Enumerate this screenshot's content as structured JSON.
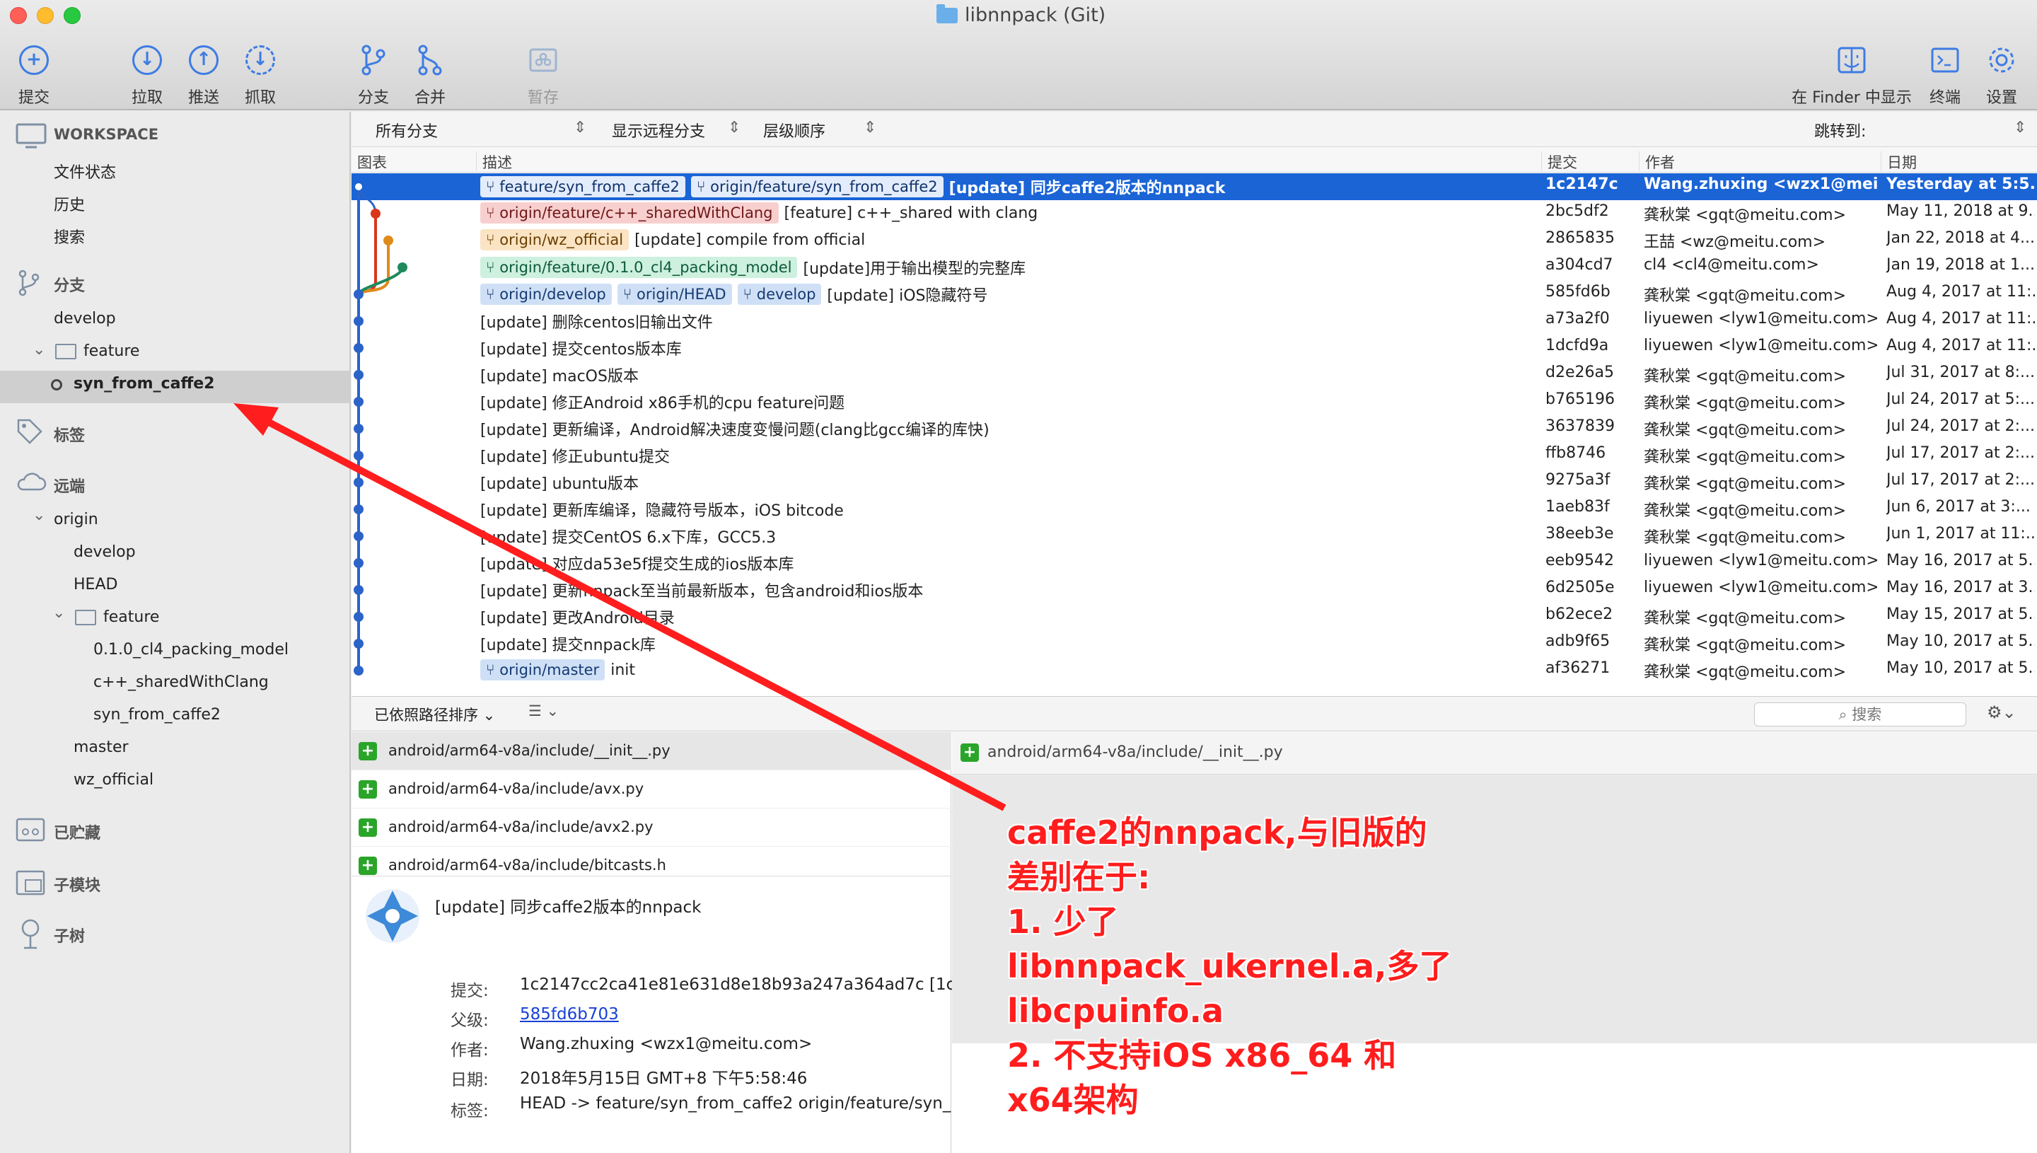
{
  "window": {
    "title": "libnnpack (Git)"
  },
  "toolbar": {
    "commit": "提交",
    "pull": "拉取",
    "push": "推送",
    "fetch": "抓取",
    "branch": "分支",
    "merge": "合并",
    "stash": "暂存",
    "finder": "在 Finder 中显示",
    "terminal": "终端",
    "settings": "设置"
  },
  "sidebar": {
    "workspace": "WORKSPACE",
    "file_status": "文件状态",
    "history": "历史",
    "search": "搜索",
    "branches": "分支",
    "develop": "develop",
    "feature": "feature",
    "syn_from_caffe2": "syn_from_caffe2",
    "tags": "标签",
    "remotes": "远端",
    "origin": "origin",
    "r_develop": "develop",
    "r_head": "HEAD",
    "r_feature": "feature",
    "r_packing": "0.1.0_cl4_packing_model",
    "r_clang": "c++_sharedWithClang",
    "r_syn": "syn_from_caffe2",
    "r_master": "master",
    "r_wz": "wz_official",
    "stashes": "已贮藏",
    "submodules": "子模块",
    "subtrees": "子树"
  },
  "filter": {
    "branches": "所有分支",
    "remote": "显示远程分支",
    "order": "层级顺序",
    "jump": "跳转到:"
  },
  "columns": {
    "graph": "图表",
    "desc": "描述",
    "commit": "提交",
    "author": "作者",
    "date": "日期"
  },
  "commits": [
    {
      "tags": [
        {
          "t": "feature/syn_from_caffe2",
          "c": "blue"
        },
        {
          "t": "origin/feature/syn_from_caffe2",
          "c": "blue"
        }
      ],
      "msg": "[update] 同步caffe2版本的nnpack",
      "hash": "1c2147c",
      "author": "Wang.zhuxing <wzx1@meit...",
      "date": "Yesterday at 5:5..."
    },
    {
      "tags": [
        {
          "t": "origin/feature/c++_sharedWithClang",
          "c": "red"
        }
      ],
      "msg": "[feature] c++_shared with clang",
      "hash": "2bc5df2",
      "author": "龚秋棠 <gqt@meitu.com>",
      "date": "May 11, 2018 at 9..."
    },
    {
      "tags": [
        {
          "t": "origin/wz_official",
          "c": "orange"
        }
      ],
      "msg": "[update] compile from official",
      "hash": "2865835",
      "author": "王喆 <wz@meitu.com>",
      "date": "Jan 22, 2018 at 4..."
    },
    {
      "tags": [
        {
          "t": "origin/feature/0.1.0_cl4_packing_model",
          "c": "green"
        }
      ],
      "msg": "[update]用于输出模型的完整库",
      "hash": "a304cd7",
      "author": "cl4 <cl4@meitu.com>",
      "date": "Jan 19, 2018 at 1..."
    },
    {
      "tags": [
        {
          "t": "origin/develop",
          "c": "blue"
        },
        {
          "t": "origin/HEAD",
          "c": "blue"
        },
        {
          "t": "develop",
          "c": "blue"
        }
      ],
      "msg": "[update] iOS隐藏符号",
      "hash": "585fd6b",
      "author": "龚秋棠 <gqt@meitu.com>",
      "date": "Aug 4, 2017 at 11:..."
    },
    {
      "tags": [],
      "msg": "[update] 删除centos旧输出文件",
      "hash": "a73a2f0",
      "author": "liyuewen <lyw1@meitu.com>",
      "date": "Aug 4, 2017 at 11:..."
    },
    {
      "tags": [],
      "msg": "[update] 提交centos版本库",
      "hash": "1dcfd9a",
      "author": "liyuewen <lyw1@meitu.com>",
      "date": "Aug 4, 2017 at 11:..."
    },
    {
      "tags": [],
      "msg": "[update] macOS版本",
      "hash": "d2e26a5",
      "author": "龚秋棠 <gqt@meitu.com>",
      "date": "Jul 31, 2017 at 8:..."
    },
    {
      "tags": [],
      "msg": "[update] 修正Android x86手机的cpu feature问题",
      "hash": "b765196",
      "author": "龚秋棠 <gqt@meitu.com>",
      "date": "Jul 24, 2017 at 5:..."
    },
    {
      "tags": [],
      "msg": "[update] 更新编译，Android解决速度变慢问题(clang比gcc编译的库快)",
      "hash": "3637839",
      "author": "龚秋棠 <gqt@meitu.com>",
      "date": "Jul 24, 2017 at 2:..."
    },
    {
      "tags": [],
      "msg": "[update] 修正ubuntu提交",
      "hash": "ffb8746",
      "author": "龚秋棠 <gqt@meitu.com>",
      "date": "Jul 17, 2017 at 2:..."
    },
    {
      "tags": [],
      "msg": "[update] ubuntu版本",
      "hash": "9275a3f",
      "author": "龚秋棠 <gqt@meitu.com>",
      "date": "Jul 17, 2017 at 2:..."
    },
    {
      "tags": [],
      "msg": "[update] 更新库编译，隐藏符号版本，iOS bitcode",
      "hash": "1aeb83f",
      "author": "龚秋棠 <gqt@meitu.com>",
      "date": "Jun 6, 2017 at 3:..."
    },
    {
      "tags": [],
      "msg": "[update] 提交CentOS 6.x下库，GCC5.3",
      "hash": "38eeb3e",
      "author": "龚秋棠 <gqt@meitu.com>",
      "date": "Jun 1, 2017 at 11:..."
    },
    {
      "tags": [],
      "msg": "[update] 对应da53e5f提交生成的ios版本库",
      "hash": "eeb9542",
      "author": "liyuewen <lyw1@meitu.com>",
      "date": "May 16, 2017 at 5..."
    },
    {
      "tags": [],
      "msg": "[update] 更新nnpack至当前最新版本，包含android和ios版本",
      "hash": "6d2505e",
      "author": "liyuewen <lyw1@meitu.com>",
      "date": "May 16, 2017 at 3..."
    },
    {
      "tags": [],
      "msg": "[update] 更改Android目录",
      "hash": "b62ece2",
      "author": "龚秋棠 <gqt@meitu.com>",
      "date": "May 15, 2017 at 5..."
    },
    {
      "tags": [],
      "msg": "[update] 提交nnpack库",
      "hash": "adb9f65",
      "author": "龚秋棠 <gqt@meitu.com>",
      "date": "May 10, 2017 at 5..."
    },
    {
      "tags": [
        {
          "t": "origin/master",
          "c": "blue"
        }
      ],
      "msg": "init",
      "hash": "af36271",
      "author": "龚秋棠 <gqt@meitu.com>",
      "date": "May 10, 2017 at 5..."
    }
  ],
  "files_bar": {
    "sort": "已依照路径排序",
    "search_placeholder": "搜索"
  },
  "files": [
    "android/arm64-v8a/include/__init__.py",
    "android/arm64-v8a/include/avx.py",
    "android/arm64-v8a/include/avx2.py",
    "android/arm64-v8a/include/bitcasts.h"
  ],
  "commit_detail": {
    "subject": "[update] 同步caffe2版本的nnpack",
    "commit_label": "提交:",
    "commit_value": "1c2147cc2ca41e81e631d8e18b93a247a364ad7c [1c",
    "parent_label": "父级:",
    "parent_value": "585fd6b703",
    "author_label": "作者:",
    "author_value": "Wang.zhuxing <wzx1@meitu.com>",
    "date_label": "日期:",
    "date_value": "2018年5月15日 GMT+8 下午5:58:46",
    "tags_label": "标签:",
    "tags_value": "HEAD -> feature/syn_from_caffe2 origin/feature/syn_"
  },
  "diff": {
    "file": "android/arm64-v8a/include/__init__.py"
  },
  "annotation": "caffe2的nnpack,与旧版的\n差别在于:\n1. 少了\nlibnnpack_ukernel.a,多了\nlibcpuinfo.a\n2. 不支持iOS x86_64 和\nx64架构",
  "colors": {
    "accent": "#1a64d6",
    "annotation": "#ff1d1d",
    "graph_main": "#2b63c9",
    "graph_red": "#d9361c",
    "graph_orange": "#e08a1a",
    "graph_green": "#1e8a5c"
  }
}
